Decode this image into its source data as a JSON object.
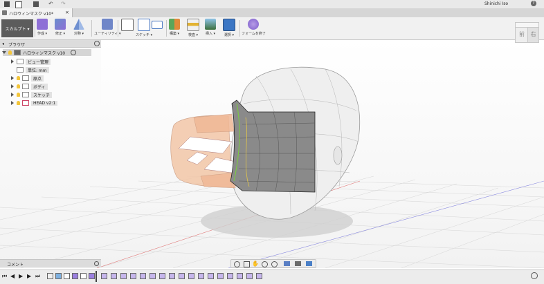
{
  "titlebar": {
    "user": "Shinichi Iso",
    "help": "?"
  },
  "document_tab": {
    "title": "ハロウィンマスク v10*",
    "close": "×"
  },
  "workspace": {
    "label": "スカルプト ▾"
  },
  "toolbar": [
    {
      "label": "作成 ▾"
    },
    {
      "label": "修正 ▾"
    },
    {
      "label": "対称 ▾"
    },
    {
      "label": "ユーティリティ ▾"
    },
    {
      "label": "スケッチ ▾"
    },
    {
      "label": "構築 ▾"
    },
    {
      "label": "検査 ▾"
    },
    {
      "label": "挿入 ▾"
    },
    {
      "label": "選択 ▾"
    },
    {
      "label": "フォームを終了"
    }
  ],
  "viewcube": {
    "front": "前",
    "right": "右"
  },
  "browser": {
    "header": "ブラウザ",
    "root": "ハロウィンマスク v10",
    "items": [
      {
        "label": "ビュー管理"
      },
      {
        "label": "単位: mm"
      },
      {
        "label": "原点"
      },
      {
        "label": "ボディ"
      },
      {
        "label": "スケッチ"
      },
      {
        "label": "HEAD v2:1"
      }
    ]
  },
  "comments": {
    "label": "コメント"
  },
  "timeline": {
    "visible_markers": 24
  }
}
